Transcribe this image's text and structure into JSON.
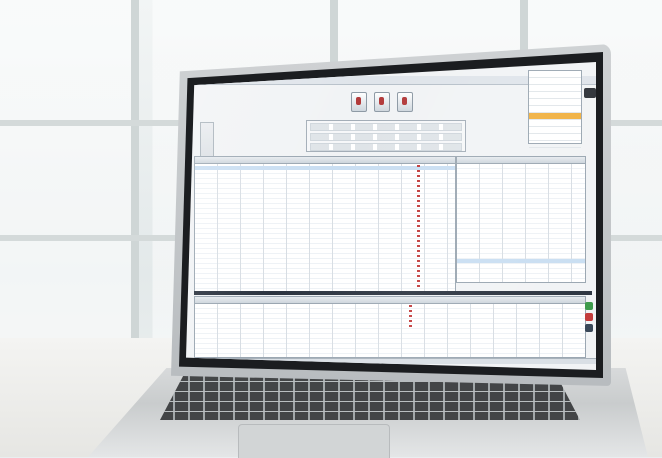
{
  "scene": {
    "subject": "laptop-screen",
    "colors": {
      "accent_orange": "#f0b040",
      "selection_blue": "#c9def2",
      "flag_red": "#c23a3a",
      "bezel": "#1b1d20"
    }
  },
  "screen_ui": {
    "menu": [
      "",
      "",
      "",
      "",
      ""
    ],
    "toolbar_icons": [
      "tool-icon",
      "tool-icon",
      "tool-icon"
    ],
    "right_panel_rows": 11,
    "right_panel_selected_row": 6
  }
}
